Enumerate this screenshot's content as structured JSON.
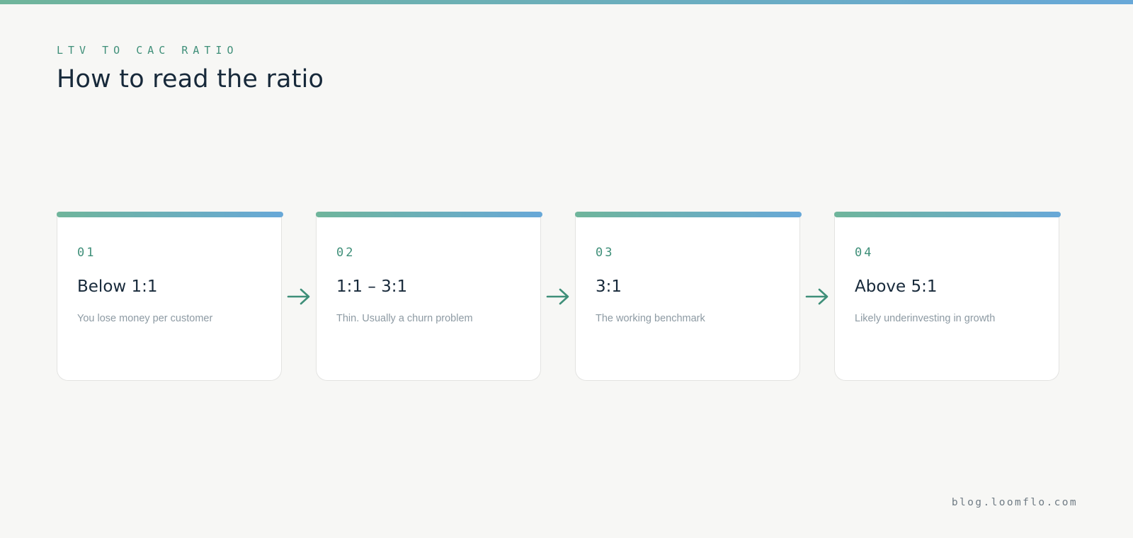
{
  "header": {
    "eyebrow": "LTV TO CAC RATIO",
    "title": "How to read the ratio"
  },
  "steps": [
    {
      "number": "01",
      "title": "Below 1:1",
      "description": "You lose money per customer"
    },
    {
      "number": "02",
      "title": "1:1 – 3:1",
      "description": "Thin. Usually a churn problem"
    },
    {
      "number": "03",
      "title": "3:1",
      "description": "The working benchmark"
    },
    {
      "number": "04",
      "title": "Above 5:1",
      "description": "Likely underinvesting in growth"
    }
  ],
  "footer": {
    "site": "blog.loomflo.com"
  },
  "colors": {
    "accent_green": "#3f8f79",
    "gradient_start": "#6fb59b",
    "gradient_end": "#68a8d8",
    "title_text": "#17293a",
    "muted_text": "#8d9aa3",
    "background": "#f7f7f5"
  },
  "icons": {
    "connector": "arrow-right-icon"
  }
}
